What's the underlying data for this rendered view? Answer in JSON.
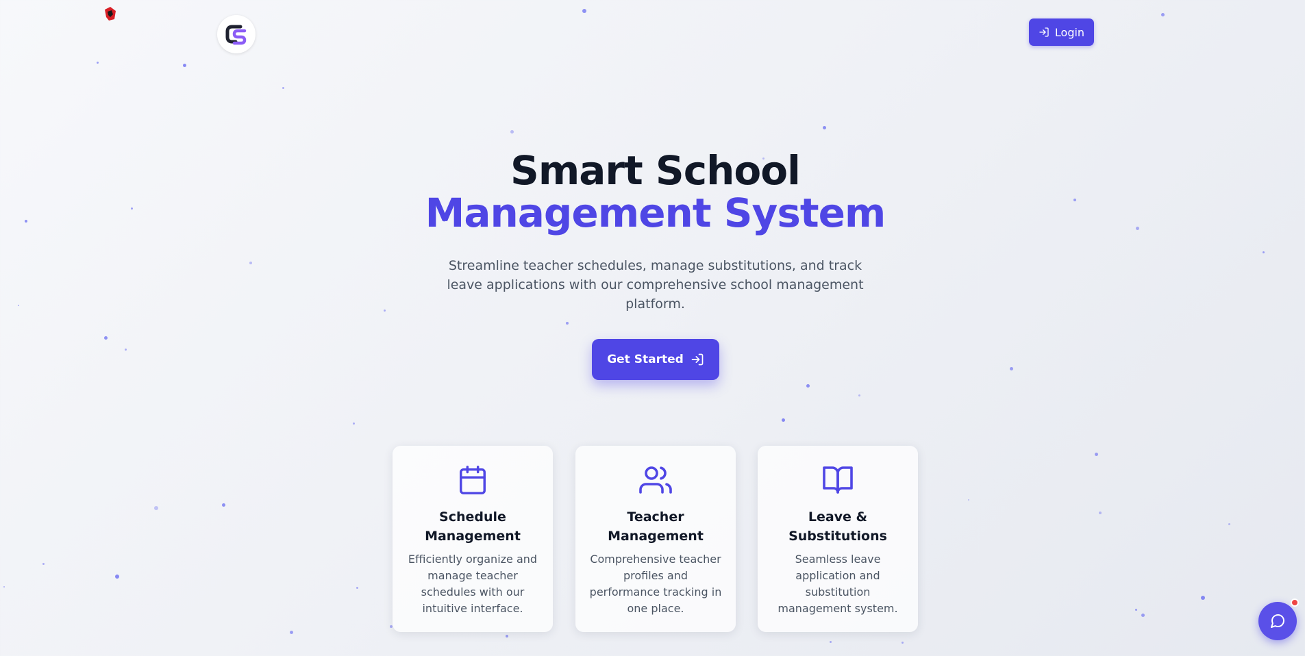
{
  "colors": {
    "accent": "#4f46e5",
    "heading": "#111827",
    "body_text": "#4b5563",
    "badge": "#ef4444"
  },
  "header": {
    "login_label": "Login",
    "login_icon": "log-in-icon",
    "brand_icon": "cs-logo"
  },
  "hero": {
    "title_line1": "Smart School",
    "title_line2": "Management System",
    "subtitle": "Streamline teacher schedules, manage substitutions, and track leave applications with our comprehensive school management platform.",
    "cta_label": "Get Started",
    "cta_icon": "log-in-icon"
  },
  "features": [
    {
      "icon": "calendar-icon",
      "title": "Schedule Management",
      "description": "Efficiently organize and manage teacher schedules with our intuitive interface."
    },
    {
      "icon": "users-icon",
      "title": "Teacher Management",
      "description": "Comprehensive teacher profiles and performance tracking in one place."
    },
    {
      "icon": "book-open-icon",
      "title": "Leave & Substitutions",
      "description": "Seamless leave application and substitution management system."
    }
  ],
  "chat": {
    "icon": "message-circle-icon",
    "has_notification": true
  }
}
